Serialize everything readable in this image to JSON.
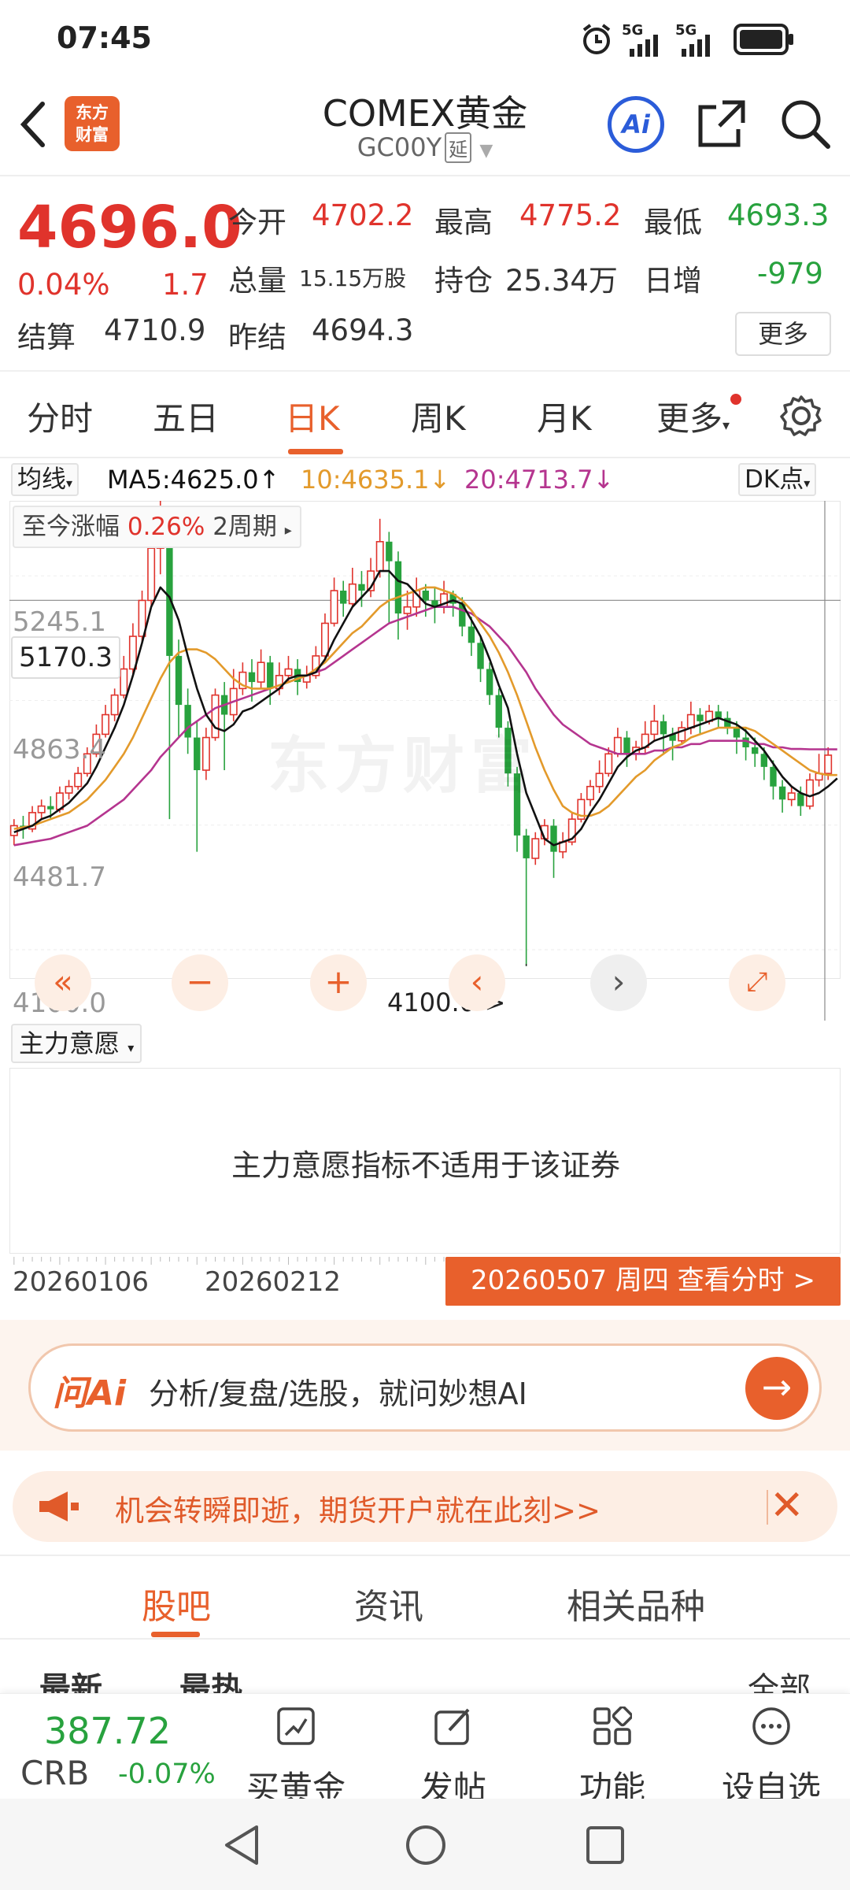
{
  "status_bar": {
    "time": "07:45",
    "signal1": "5G",
    "signal2": "5G"
  },
  "header": {
    "logo_text": "东方财富",
    "title": "COMEX黄金",
    "code": "GC00Y",
    "delay_tag": "延",
    "ai_label": "Ai"
  },
  "quote": {
    "price": "4696.0",
    "change_pct": "0.04%",
    "change": "1.7",
    "open_label": "今开",
    "open": "4702.2",
    "high_label": "最高",
    "high": "4775.2",
    "low_label": "最低",
    "low": "4693.3",
    "volume_label": "总量",
    "volume": "15.15万股",
    "oi_label": "持仓",
    "oi": "25.34万",
    "daily_inc_label": "日增",
    "daily_inc": "-979",
    "settle_label": "结算",
    "settle": "4710.9",
    "prev_settle_label": "昨结",
    "prev_settle": "4694.3",
    "more": "更多"
  },
  "tabs": [
    "分时",
    "五日",
    "日K",
    "周K",
    "月K",
    "更多"
  ],
  "active_tab": "日K",
  "ma": {
    "selector": "均线",
    "ma5": "MA5:4625.0",
    "ma10": "10:4635.1",
    "ma20": "20:4713.7",
    "dk": "DK点"
  },
  "chart_overlay": {
    "change_label": "至今涨幅",
    "change_value": "0.26%",
    "period": "2周期",
    "cursor_price": "5170.3",
    "low_marker": "4100.0->",
    "watermark": "东方财富"
  },
  "chart_data": {
    "type": "candlestick",
    "y_ticks": [
      "5245.1",
      "4863.4",
      "4481.7",
      "4100.0"
    ],
    "ylim": [
      4100.0,
      5475
    ],
    "x_labels": [
      "20260106",
      "20260212"
    ],
    "series_names": [
      "MA5",
      "MA10",
      "MA20"
    ],
    "candles": [
      [
        4450,
        4480,
        4420,
        4500
      ],
      [
        4480,
        4470,
        4440,
        4510
      ],
      [
        4470,
        4520,
        4460,
        4540
      ],
      [
        4520,
        4540,
        4500,
        4560
      ],
      [
        4540,
        4530,
        4500,
        4570
      ],
      [
        4530,
        4580,
        4520,
        4600
      ],
      [
        4580,
        4600,
        4560,
        4620
      ],
      [
        4600,
        4640,
        4590,
        4660
      ],
      [
        4640,
        4700,
        4630,
        4720
      ],
      [
        4700,
        4760,
        4690,
        4790
      ],
      [
        4760,
        4820,
        4750,
        4850
      ],
      [
        4820,
        4880,
        4800,
        4900
      ],
      [
        4880,
        4960,
        4870,
        5000
      ],
      [
        4960,
        5060,
        4940,
        5100
      ],
      [
        5060,
        5170,
        5040,
        5200
      ],
      [
        5170,
        5330,
        5150,
        5400
      ],
      [
        5330,
        5400,
        5250,
        5480
      ],
      [
        5400,
        5000,
        4500,
        5420
      ],
      [
        5000,
        4850,
        4750,
        5050
      ],
      [
        4850,
        4750,
        4700,
        4900
      ],
      [
        4750,
        4650,
        4400,
        4800
      ],
      [
        4650,
        4750,
        4620,
        4780
      ],
      [
        4750,
        4880,
        4740,
        4900
      ],
      [
        4880,
        4820,
        4650,
        4920
      ],
      [
        4820,
        4900,
        4800,
        4960
      ],
      [
        4900,
        4950,
        4880,
        4980
      ],
      [
        4950,
        4920,
        4860,
        4990
      ],
      [
        4920,
        4980,
        4900,
        5020
      ],
      [
        4980,
        4900,
        4850,
        5000
      ],
      [
        4900,
        4940,
        4880,
        4980
      ],
      [
        4940,
        4960,
        4920,
        5000
      ],
      [
        4960,
        4920,
        4880,
        4990
      ],
      [
        4920,
        4940,
        4900,
        4970
      ],
      [
        4940,
        5000,
        4930,
        5030
      ],
      [
        5000,
        5100,
        4990,
        5130
      ],
      [
        5100,
        5200,
        5090,
        5240
      ],
      [
        5200,
        5160,
        5120,
        5230
      ],
      [
        5160,
        5220,
        5150,
        5270
      ],
      [
        5220,
        5200,
        5150,
        5260
      ],
      [
        5200,
        5260,
        5180,
        5300
      ],
      [
        5260,
        5350,
        5240,
        5420
      ],
      [
        5350,
        5290,
        5100,
        5380
      ],
      [
        5290,
        5130,
        5050,
        5320
      ],
      [
        5130,
        5150,
        5080,
        5200
      ],
      [
        5150,
        5200,
        5120,
        5240
      ],
      [
        5200,
        5170,
        5120,
        5220
      ],
      [
        5170,
        5150,
        5100,
        5210
      ],
      [
        5150,
        5190,
        5130,
        5230
      ],
      [
        5190,
        5160,
        5120,
        5200
      ],
      [
        5160,
        5090,
        5060,
        5180
      ],
      [
        5090,
        5040,
        5000,
        5120
      ],
      [
        5040,
        4960,
        4920,
        5060
      ],
      [
        4960,
        4880,
        4850,
        4980
      ],
      [
        4880,
        4780,
        4750,
        4900
      ],
      [
        4780,
        4640,
        4600,
        4800
      ],
      [
        4640,
        4450,
        4400,
        4660
      ],
      [
        4450,
        4380,
        4050,
        4470
      ],
      [
        4380,
        4440,
        4360,
        4460
      ],
      [
        4440,
        4480,
        4420,
        4500
      ],
      [
        4480,
        4400,
        4320,
        4500
      ],
      [
        4400,
        4430,
        4380,
        4460
      ],
      [
        4430,
        4500,
        4420,
        4520
      ],
      [
        4500,
        4560,
        4490,
        4580
      ],
      [
        4560,
        4600,
        4540,
        4620
      ],
      [
        4600,
        4640,
        4580,
        4680
      ],
      [
        4640,
        4700,
        4630,
        4720
      ],
      [
        4700,
        4750,
        4690,
        4780
      ],
      [
        4750,
        4700,
        4660,
        4770
      ],
      [
        4700,
        4720,
        4680,
        4740
      ],
      [
        4720,
        4760,
        4700,
        4800
      ],
      [
        4760,
        4800,
        4740,
        4850
      ],
      [
        4800,
        4760,
        4700,
        4820
      ],
      [
        4760,
        4740,
        4680,
        4780
      ],
      [
        4740,
        4780,
        4730,
        4800
      ],
      [
        4780,
        4820,
        4760,
        4860
      ],
      [
        4820,
        4800,
        4760,
        4840
      ],
      [
        4800,
        4830,
        4790,
        4850
      ],
      [
        4830,
        4810,
        4780,
        4850
      ],
      [
        4810,
        4780,
        4760,
        4830
      ],
      [
        4780,
        4750,
        4700,
        4800
      ],
      [
        4750,
        4720,
        4680,
        4780
      ],
      [
        4720,
        4700,
        4660,
        4750
      ],
      [
        4700,
        4660,
        4620,
        4720
      ],
      [
        4660,
        4600,
        4560,
        4680
      ],
      [
        4600,
        4560,
        4520,
        4620
      ],
      [
        4560,
        4580,
        4540,
        4600
      ],
      [
        4580,
        4540,
        4510,
        4600
      ],
      [
        4540,
        4620,
        4530,
        4640
      ],
      [
        4620,
        4640,
        4600,
        4700
      ],
      [
        4640,
        4696,
        4620,
        4720
      ]
    ],
    "ma5": [
      4460,
      4470,
      4480,
      4500,
      4510,
      4530,
      4550,
      4580,
      4610,
      4660,
      4720,
      4780,
      4850,
      4940,
      5040,
      5150,
      5210,
      5180,
      5110,
      5000,
      4900,
      4820,
      4780,
      4770,
      4790,
      4830,
      4840,
      4860,
      4880,
      4900,
      4930,
      4940,
      4940,
      4950,
      4990,
      5050,
      5100,
      5150,
      5180,
      5210,
      5260,
      5260,
      5230,
      5220,
      5190,
      5160,
      5150,
      5160,
      5170,
      5160,
      5110,
      5060,
      4990,
      4910,
      4840,
      4700,
      4580,
      4510,
      4440,
      4420,
      4430,
      4440,
      4470,
      4520,
      4560,
      4610,
      4660,
      4690,
      4710,
      4720,
      4740,
      4750,
      4760,
      4770,
      4780,
      4790,
      4800,
      4810,
      4800,
      4790,
      4770,
      4740,
      4710,
      4670,
      4630,
      4600,
      4580,
      4570,
      4580,
      4600,
      4625
    ],
    "ma10": [
      4470,
      4475,
      4480,
      4490,
      4500,
      4510,
      4520,
      4540,
      4560,
      4590,
      4620,
      4660,
      4700,
      4750,
      4810,
      4870,
      4930,
      4980,
      5010,
      5020,
      5020,
      5010,
      4990,
      4960,
      4930,
      4910,
      4900,
      4900,
      4900,
      4910,
      4920,
      4930,
      4940,
      4960,
      4980,
      5010,
      5040,
      5070,
      5090,
      5120,
      5150,
      5170,
      5180,
      5190,
      5200,
      5210,
      5210,
      5200,
      5190,
      5170,
      5140,
      5100,
      5060,
      5010,
      4950,
      4880,
      4800,
      4720,
      4650,
      4590,
      4540,
      4520,
      4510,
      4510,
      4520,
      4540,
      4570,
      4600,
      4630,
      4650,
      4680,
      4700,
      4720,
      4730,
      4750,
      4760,
      4770,
      4780,
      4780,
      4780,
      4780,
      4770,
      4750,
      4730,
      4710,
      4690,
      4670,
      4650,
      4640,
      4635,
      4635
    ],
    "ma20": [
      4420,
      4425,
      4430,
      4435,
      4440,
      4450,
      4460,
      4470,
      4480,
      4500,
      4520,
      4540,
      4560,
      4590,
      4620,
      4650,
      4690,
      4720,
      4750,
      4780,
      4800,
      4820,
      4840,
      4850,
      4860,
      4870,
      4880,
      4890,
      4900,
      4910,
      4920,
      4930,
      4940,
      4950,
      4960,
      4980,
      5000,
      5020,
      5040,
      5060,
      5080,
      5100,
      5110,
      5120,
      5130,
      5140,
      5150,
      5150,
      5150,
      5140,
      5130,
      5110,
      5090,
      5060,
      5030,
      4990,
      4950,
      4900,
      4860,
      4820,
      4790,
      4770,
      4750,
      4730,
      4720,
      4710,
      4700,
      4700,
      4700,
      4700,
      4710,
      4710,
      4720,
      4720,
      4730,
      4730,
      4740,
      4740,
      4740,
      4740,
      4740,
      4730,
      4730,
      4720,
      4720,
      4715,
      4715,
      4714,
      4714,
      4714,
      4713.7
    ]
  },
  "controls": {
    "prev_fast": "«",
    "zoom_out": "−",
    "zoom_in": "+",
    "prev": "‹",
    "next": "›",
    "fullscreen": "⤢"
  },
  "indicator": {
    "selector": "主力意愿",
    "message": "主力意愿指标不适用于该证券"
  },
  "date_axis": {
    "d1": "20260106",
    "d2": "20260212",
    "tooltip": "20260507 周四 查看分时 >"
  },
  "ai_bar": {
    "logo": "问Ai",
    "placeholder": "分析/复盘/选股，就问妙想AI",
    "go": "→"
  },
  "promo": {
    "text": "机会转瞬即逝，期货开户就在此刻>>",
    "close": "✕"
  },
  "section_tabs": [
    "股吧",
    "资讯",
    "相关品种"
  ],
  "filters": {
    "latest": "最新",
    "hot": "最热",
    "all": "全部"
  },
  "bottom_bar": {
    "crb_value": "387.72",
    "crb_name": "CRB",
    "crb_change": "-0.07%",
    "items": [
      "买黄金",
      "发帖",
      "功能",
      "设自选"
    ]
  },
  "colors": {
    "up": "#e0332c",
    "down": "#28a23e",
    "accent": "#e8602c",
    "ma5": "#111111",
    "ma10": "#e39a2b",
    "ma20": "#b5358f"
  }
}
